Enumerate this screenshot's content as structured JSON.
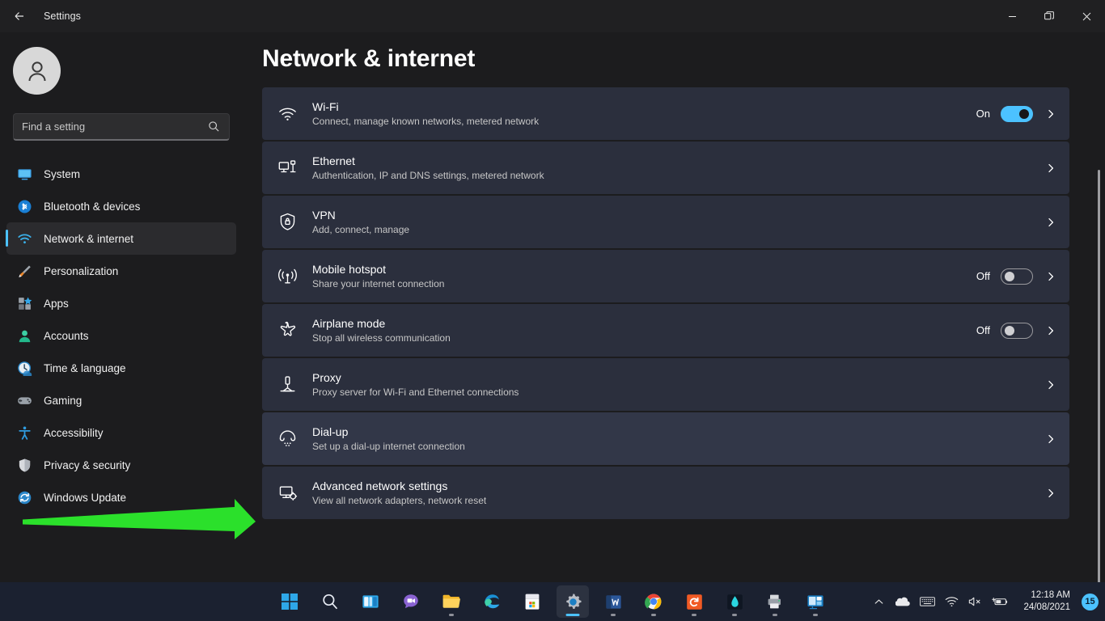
{
  "colors": {
    "accent": "#4cc2ff",
    "page_bg": "#1c1c1e",
    "card_bg": "#2b2f3d",
    "taskbar_bg": "#1b2130",
    "annotation_arrow": "#2be02b"
  },
  "titlebar": {
    "back_label": "Back",
    "title": "Settings",
    "minimize_label": "Minimize",
    "restore_label": "Restore Down",
    "close_label": "Close"
  },
  "sidebar": {
    "account_name": "User account",
    "search": {
      "placeholder": "Find a setting",
      "value": ""
    },
    "items": [
      {
        "label": "System",
        "icon": "monitor-icon",
        "active": false
      },
      {
        "label": "Bluetooth & devices",
        "icon": "bluetooth-icon",
        "active": false
      },
      {
        "label": "Network & internet",
        "icon": "wifi-icon",
        "active": true
      },
      {
        "label": "Personalization",
        "icon": "brush-icon",
        "active": false
      },
      {
        "label": "Apps",
        "icon": "apps-icon",
        "active": false
      },
      {
        "label": "Accounts",
        "icon": "person-icon",
        "active": false
      },
      {
        "label": "Time & language",
        "icon": "clock-icon",
        "active": false
      },
      {
        "label": "Gaming",
        "icon": "gamepad-icon",
        "active": false
      },
      {
        "label": "Accessibility",
        "icon": "accessibility-icon",
        "active": false
      },
      {
        "label": "Privacy & security",
        "icon": "shield-icon",
        "active": false
      },
      {
        "label": "Windows Update",
        "icon": "update-icon",
        "active": false
      }
    ]
  },
  "main": {
    "page_title": "Network & internet",
    "cards": [
      {
        "title": "Wi-Fi",
        "subtitle": "Connect, manage known networks, metered network",
        "icon": "wifi-icon",
        "toggle": {
          "present": true,
          "state": "On"
        },
        "hovered": false
      },
      {
        "title": "Ethernet",
        "subtitle": "Authentication, IP and DNS settings, metered network",
        "icon": "ethernet-icon",
        "toggle": {
          "present": false,
          "state": ""
        },
        "hovered": false
      },
      {
        "title": "VPN",
        "subtitle": "Add, connect, manage",
        "icon": "vpn-shield-icon",
        "toggle": {
          "present": false,
          "state": ""
        },
        "hovered": false
      },
      {
        "title": "Mobile hotspot",
        "subtitle": "Share your internet connection",
        "icon": "hotspot-icon",
        "toggle": {
          "present": true,
          "state": "Off"
        },
        "hovered": false
      },
      {
        "title": "Airplane mode",
        "subtitle": "Stop all wireless communication",
        "icon": "airplane-icon",
        "toggle": {
          "present": true,
          "state": "Off"
        },
        "hovered": false
      },
      {
        "title": "Proxy",
        "subtitle": "Proxy server for Wi-Fi and Ethernet connections",
        "icon": "proxy-icon",
        "toggle": {
          "present": false,
          "state": ""
        },
        "hovered": false
      },
      {
        "title": "Dial-up",
        "subtitle": "Set up a dial-up internet connection",
        "icon": "dialup-icon",
        "toggle": {
          "present": false,
          "state": ""
        },
        "hovered": true
      },
      {
        "title": "Advanced network settings",
        "subtitle": "View all network adapters, network reset",
        "icon": "advanced-network-icon",
        "toggle": {
          "present": false,
          "state": ""
        },
        "hovered": false
      }
    ]
  },
  "taskbar": {
    "items": [
      {
        "name": "start-button",
        "label": "Start",
        "active": false,
        "running": false
      },
      {
        "name": "search-button",
        "label": "Search",
        "active": false,
        "running": false
      },
      {
        "name": "task-view-button",
        "label": "Task View",
        "active": false,
        "running": false
      },
      {
        "name": "chat-button",
        "label": "Chat",
        "active": false,
        "running": false
      },
      {
        "name": "file-explorer-button",
        "label": "File Explorer",
        "active": false,
        "running": true
      },
      {
        "name": "edge-button",
        "label": "Microsoft Edge",
        "active": false,
        "running": false
      },
      {
        "name": "microsoft-store-button",
        "label": "Microsoft Store",
        "active": false,
        "running": false
      },
      {
        "name": "settings-button",
        "label": "Settings",
        "active": true,
        "running": true
      },
      {
        "name": "word-button",
        "label": "Word",
        "active": false,
        "running": true
      },
      {
        "name": "chrome-button",
        "label": "Google Chrome",
        "active": false,
        "running": true
      },
      {
        "name": "recorder-button",
        "label": "Screen Recorder",
        "active": false,
        "running": true
      },
      {
        "name": "affinity-button",
        "label": "Affinity",
        "active": false,
        "running": true
      },
      {
        "name": "printer-button",
        "label": "Printer",
        "active": false,
        "running": true
      },
      {
        "name": "remote-desktop-button",
        "label": "Remote Desktop",
        "active": false,
        "running": true
      }
    ],
    "tray": {
      "icons": [
        {
          "name": "show-hidden-icons-icon",
          "label": "Show hidden icons"
        },
        {
          "name": "onedrive-icon",
          "label": "OneDrive"
        },
        {
          "name": "keyboard-icon",
          "label": "Touch keyboard"
        },
        {
          "name": "wifi-icon",
          "label": "Network"
        },
        {
          "name": "volume-muted-icon",
          "label": "Volume muted"
        },
        {
          "name": "battery-charging-icon",
          "label": "Battery charging"
        }
      ],
      "time": "12:18 AM",
      "date": "24/08/2021",
      "notification_count": "15"
    }
  }
}
